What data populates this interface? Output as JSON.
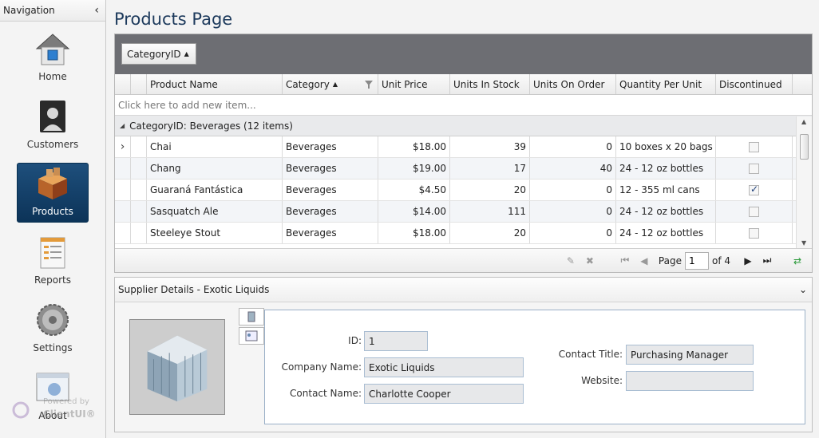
{
  "nav": {
    "header": "Navigation",
    "items": [
      {
        "label": "Home",
        "icon": "home-icon"
      },
      {
        "label": "Customers",
        "icon": "customers-icon"
      },
      {
        "label": "Products",
        "icon": "products-icon"
      },
      {
        "label": "Reports",
        "icon": "reports-icon"
      },
      {
        "label": "Settings",
        "icon": "settings-icon"
      },
      {
        "label": "About",
        "icon": "about-icon"
      }
    ],
    "active": "Products",
    "powered_by": "Powered by",
    "brand": "ClientUI®"
  },
  "page": {
    "title": "Products Page"
  },
  "grid": {
    "group_chip": "CategoryID",
    "columns": [
      "Product Name",
      "Category",
      "Unit Price",
      "Units In Stock",
      "Units On Order",
      "Quantity Per Unit",
      "Discontinued"
    ],
    "add_new": "Click here to add new item...",
    "group_label": "CategoryID: Beverages (12 items)",
    "rows": [
      {
        "name": "Chai",
        "category": "Beverages",
        "price": "$18.00",
        "stock": "39",
        "order": "0",
        "qpu": "10 boxes x 20 bags",
        "discontinued": false
      },
      {
        "name": "Chang",
        "category": "Beverages",
        "price": "$19.00",
        "stock": "17",
        "order": "40",
        "qpu": "24 - 12 oz bottles",
        "discontinued": false
      },
      {
        "name": "Guaraná Fantástica",
        "category": "Beverages",
        "price": "$4.50",
        "stock": "20",
        "order": "0",
        "qpu": "12 - 355 ml cans",
        "discontinued": true
      },
      {
        "name": "Sasquatch Ale",
        "category": "Beverages",
        "price": "$14.00",
        "stock": "111",
        "order": "0",
        "qpu": "24 - 12 oz bottles",
        "discontinued": false
      },
      {
        "name": "Steeleye Stout",
        "category": "Beverages",
        "price": "$18.00",
        "stock": "20",
        "order": "0",
        "qpu": "24 - 12 oz bottles",
        "discontinued": false
      }
    ],
    "pager": {
      "page_label": "Page",
      "page_value": "1",
      "of_label": "of 4"
    }
  },
  "details": {
    "title": "Supplier Details - Exotic Liquids",
    "labels": {
      "id": "ID:",
      "company": "Company Name:",
      "contact": "Contact Name:",
      "contact_title": "Contact Title:",
      "website": "Website:"
    },
    "values": {
      "id": "1",
      "company": "Exotic Liquids",
      "contact": "Charlotte Cooper",
      "contact_title": "Purchasing Manager",
      "website": ""
    }
  }
}
